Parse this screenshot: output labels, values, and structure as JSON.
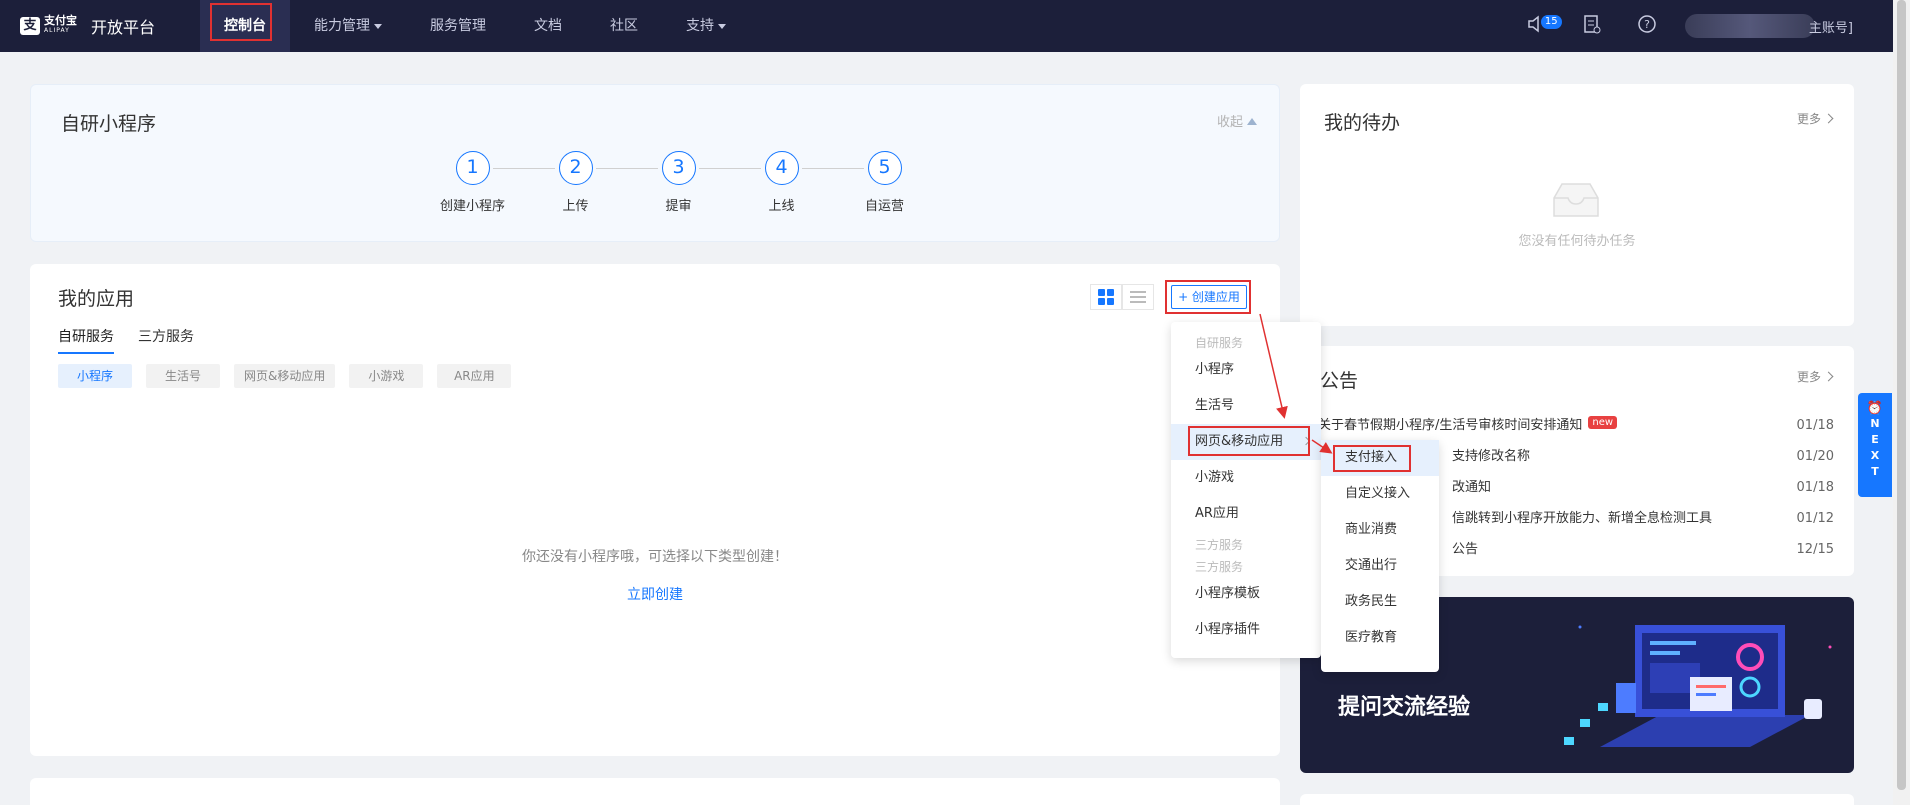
{
  "nav": {
    "logo_text": "支付宝",
    "logo_sub": "ALIPAY",
    "brand_name": "开放平台",
    "items": [
      {
        "label": "控制台"
      },
      {
        "label": "能力管理"
      },
      {
        "label": "服务管理"
      },
      {
        "label": "文档"
      },
      {
        "label": "社区"
      },
      {
        "label": "支持"
      }
    ],
    "notification_count": "15",
    "account_label": "主账号]"
  },
  "self_dev": {
    "title": "自研小程序",
    "collapse_label": "收起",
    "steps": [
      {
        "num": "1",
        "label": "创建小程序"
      },
      {
        "num": "2",
        "label": "上传"
      },
      {
        "num": "3",
        "label": "提审"
      },
      {
        "num": "4",
        "label": "上线"
      },
      {
        "num": "5",
        "label": "自运营"
      }
    ]
  },
  "apps": {
    "title": "我的应用",
    "tabs": [
      {
        "label": "自研服务"
      },
      {
        "label": "三方服务"
      }
    ],
    "chips": [
      {
        "label": "小程序"
      },
      {
        "label": "生活号"
      },
      {
        "label": "网页&移动应用"
      },
      {
        "label": "小游戏"
      },
      {
        "label": "AR应用"
      }
    ],
    "empty_text": "你还没有小程序哦，可选择以下类型创建！",
    "create_now": "立即创建",
    "create_button": "+ 创建应用"
  },
  "dropdown": {
    "group_self": "自研服务",
    "group_third_a": "三方服务",
    "group_third_b": "三方服务",
    "items": [
      {
        "label": "小程序"
      },
      {
        "label": "生活号"
      },
      {
        "label": "网页&移动应用"
      },
      {
        "label": "小游戏"
      },
      {
        "label": "AR应用"
      },
      {
        "label": "小程序模板"
      },
      {
        "label": "小程序插件"
      }
    ]
  },
  "submenu": {
    "items": [
      {
        "label": "支付接入"
      },
      {
        "label": "自定义接入"
      },
      {
        "label": "商业消费"
      },
      {
        "label": "交通出行"
      },
      {
        "label": "政务民生"
      },
      {
        "label": "医疗教育"
      }
    ]
  },
  "todo": {
    "title": "我的待办",
    "more": "更多",
    "empty": "您没有任何待办任务"
  },
  "notice": {
    "title": "公告",
    "more": "更多",
    "new_tag": "new",
    "rows": [
      {
        "text": "关于春节假期小程序/生活号审核时间安排通知",
        "date": "01/18"
      },
      {
        "text": "支持修改名称",
        "date": "01/20"
      },
      {
        "text": "改通知",
        "date": "01/18"
      },
      {
        "text": "信跳转到小程序开放能力、新增全息检测工具",
        "date": "01/12"
      },
      {
        "text": "公告",
        "date": "12/15"
      }
    ]
  },
  "banner": {
    "text": "提问交流经验"
  },
  "next_tab": {
    "letters": [
      "N",
      "E",
      "X",
      "T"
    ]
  },
  "colors": {
    "nav_bg": "#1c1f3a",
    "accent": "#1677ff",
    "highlight": "#e03131"
  }
}
